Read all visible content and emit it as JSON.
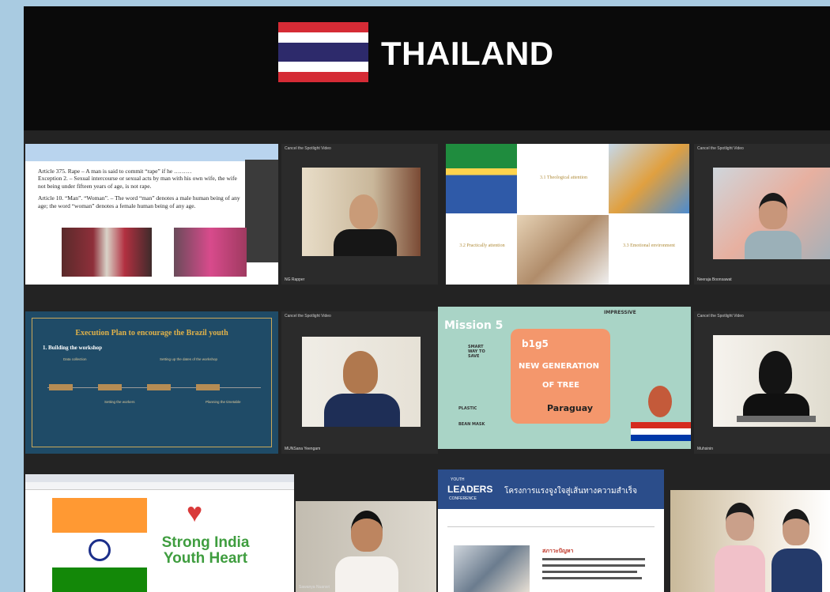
{
  "banner": {
    "country": "THAILAND",
    "flag_colors": [
      "#d52b35",
      "#ffffff",
      "#2d2a6b",
      "#ffffff",
      "#d52b35"
    ]
  },
  "tiles": {
    "legal_slide": {
      "article_375": "Article 375. Rape – A man is said to commit “rape” if he ………",
      "exception": "Exception 2. – Sexual intercourse or sexual acts by man with his own wife, the wife not being under fifteen years of age, is not rape.",
      "article_10": "Article 10. “Man”. “Woman”. – The word “man” denotes a male human being of any age; the word “woman” denotes a female human being of any age."
    },
    "brazil_slide": {
      "box1": "3.1 Theological attention",
      "box2": "3.2 Practically attention",
      "box3": "3.3 Emotional environment"
    },
    "plan_slide": {
      "title": "Execution Plan to encourage the Brazil youth",
      "subtitle": "1. Building the workshop",
      "items": [
        "Data collection",
        "Setting up the dates of the workshop",
        "Setting the workers",
        "Planning the timetable"
      ]
    },
    "mission_slide": {
      "mission": "Mission 5",
      "team": "b1g5",
      "headline1": "NEW GENERATION",
      "headline2": "OF TREE",
      "country": "Paraguay",
      "badge": "IMPRESSIVE",
      "left_note": "SMART WAY TO SAVE",
      "left_note2": "PLASTIC",
      "left_note3": "BEAN MASK"
    },
    "india_slide": {
      "line1": "Strong India",
      "line2": "Youth Heart"
    },
    "thai_slide": {
      "brand1": "YOUTH",
      "brand2": "LEADERS",
      "brand3": "CONFERENCE",
      "heading": "โครงการแรงจูงใจสู่เส้นทางความสำเร็จ",
      "section": "สภาวะปัญหา"
    }
  },
  "cams": {
    "cam1": "NG Rapper",
    "cam2": "Neeraja Boonsawat",
    "cam3": "MUNSana Yeengam",
    "cam4": "Muhsinin",
    "cam5": "Sawanya Nuansri"
  },
  "cam_tag": "Cancel the Spotlight Video"
}
